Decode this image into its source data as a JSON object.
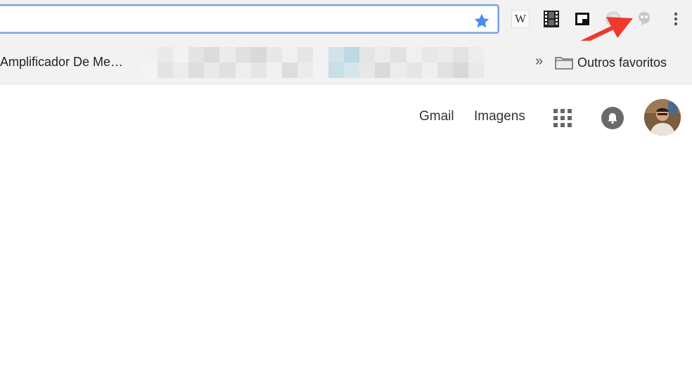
{
  "toolbar": {
    "address_value": "",
    "star_icon": "star-icon",
    "extensions": [
      {
        "name": "wikipedia-extension",
        "glyph": "W"
      },
      {
        "name": "film-extension"
      },
      {
        "name": "picture-in-picture-extension"
      },
      {
        "name": "ghost-extension"
      },
      {
        "name": "tips-extension"
      }
    ],
    "menu_icon": "more-vert-icon"
  },
  "bookmarks": {
    "first_item": "Amplificador De Me…",
    "overflow_label": "»",
    "other_bookmarks": "Outros favoritos"
  },
  "google_header": {
    "gmail": "Gmail",
    "images": "Imagens",
    "apps_icon": "apps-grid-icon",
    "notifications_icon": "bell-icon",
    "avatar": "profile-avatar"
  },
  "colors": {
    "accent_blue": "#4a8af4",
    "annotation_red": "#f0382b",
    "toolbar_bg": "#f2f2f2"
  }
}
